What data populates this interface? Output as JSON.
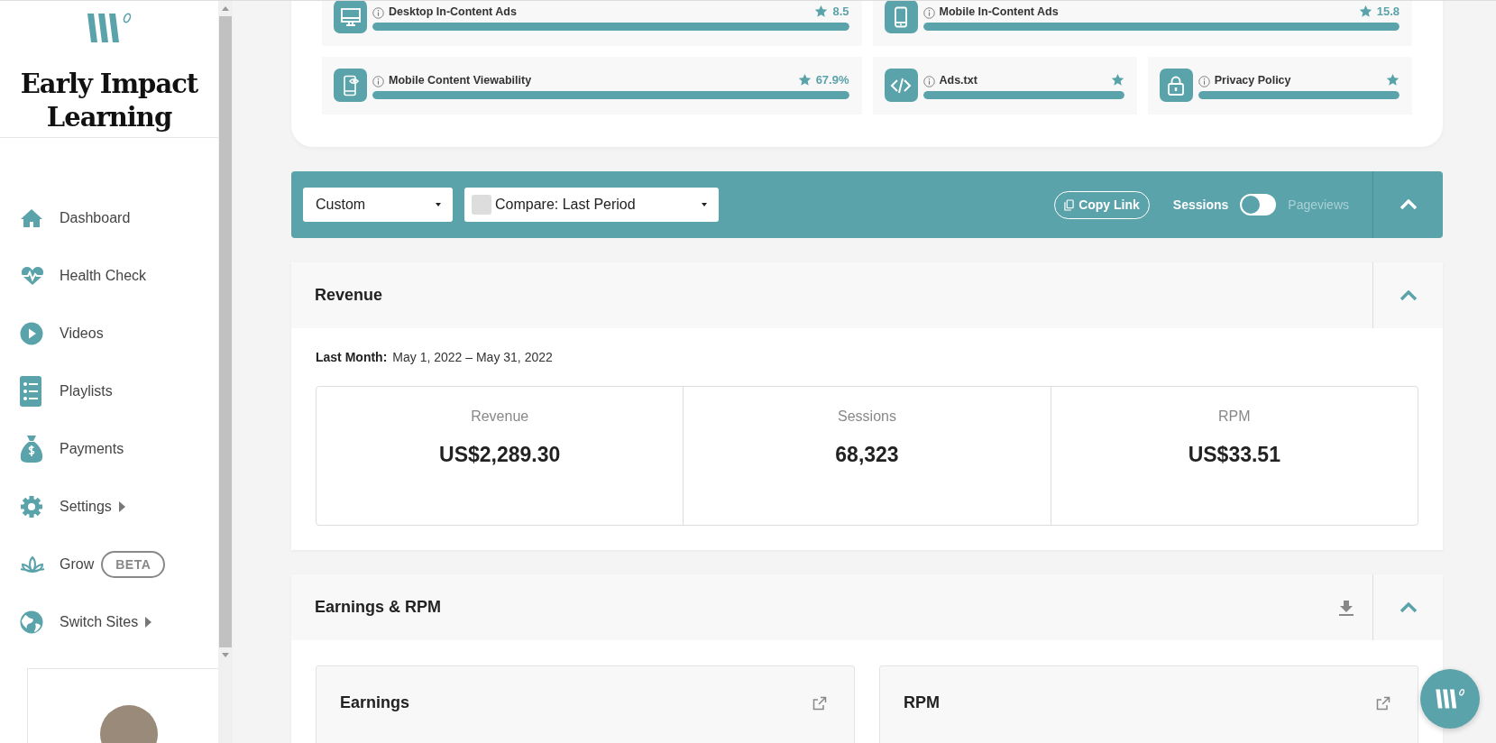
{
  "sidebar": {
    "title": "Early Impact Learning",
    "nav": [
      {
        "label": "Dashboard",
        "submenu": false
      },
      {
        "label": "Health Check",
        "submenu": false
      },
      {
        "label": "Videos",
        "submenu": false
      },
      {
        "label": "Playlists",
        "submenu": false
      },
      {
        "label": "Payments",
        "submenu": false
      },
      {
        "label": "Settings",
        "submenu": true
      },
      {
        "label": "Grow",
        "submenu": false,
        "badge": "BETA"
      },
      {
        "label": "Switch Sites",
        "submenu": true
      }
    ]
  },
  "health_checks": [
    [
      {
        "label": "Desktop In-Content Ads",
        "score": "8.5",
        "level": 1
      },
      {
        "label": "Mobile In-Content Ads",
        "score": "15.8",
        "level": 1
      }
    ],
    [
      {
        "label": "Mobile Content Viewability",
        "score": "67.9%",
        "level": 1
      },
      {
        "label": "Ads.txt",
        "level": 1
      },
      {
        "label": "Privacy Policy",
        "level": 1
      }
    ]
  ],
  "toolbar": {
    "period": "Custom",
    "compare": "Compare: Last Period",
    "copy_link": "Copy Link",
    "toggle": {
      "left": "Sessions",
      "right": "Pageviews",
      "on": false
    },
    "expanded": true
  },
  "revenue": {
    "title": "Revenue",
    "expanded": true,
    "period_label": "Last Month:",
    "period": "May 1, 2022 – May 31, 2022",
    "stats": [
      {
        "label": "Revenue",
        "value": "US$2,289.30"
      },
      {
        "label": "Sessions",
        "value": "68,323"
      },
      {
        "label": "RPM",
        "value": "US$33.51"
      }
    ]
  },
  "earnings": {
    "title": "Earnings & RPM",
    "expanded": true,
    "cards": [
      {
        "title": "Earnings"
      },
      {
        "title": "RPM"
      }
    ]
  }
}
